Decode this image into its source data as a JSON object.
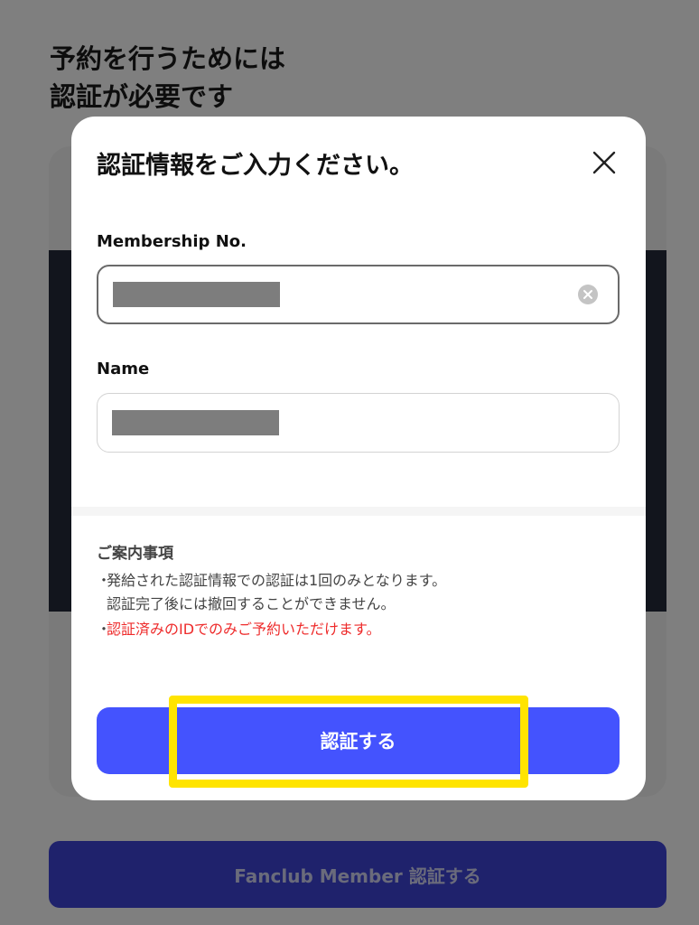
{
  "background": {
    "title_line1": "予約を行うためには",
    "title_line2": "認証が必要です",
    "fanclub_button": "Fanclub Member 認証する"
  },
  "modal": {
    "title": "認証情報をご入力ください。",
    "close_icon": "close-icon",
    "fields": [
      {
        "label": "Membership No.",
        "value": "",
        "clear_icon": "clear-circle-icon"
      },
      {
        "label": "Name",
        "value": ""
      }
    ],
    "notice": {
      "title": "ご案内事項",
      "bullet": "・",
      "line1": "発給された認証情報での認証は1回のみとなります。",
      "line2": "認証完了後には撤回することができません。",
      "warning": "認証済みのIDでのみご予約いただけます。"
    },
    "submit_label": "認証する"
  },
  "colors": {
    "primary": "#4453fe",
    "warning": "#ee2b2b",
    "highlight": "#ffe400",
    "overlay": "rgba(0,0,0,0.5)"
  }
}
